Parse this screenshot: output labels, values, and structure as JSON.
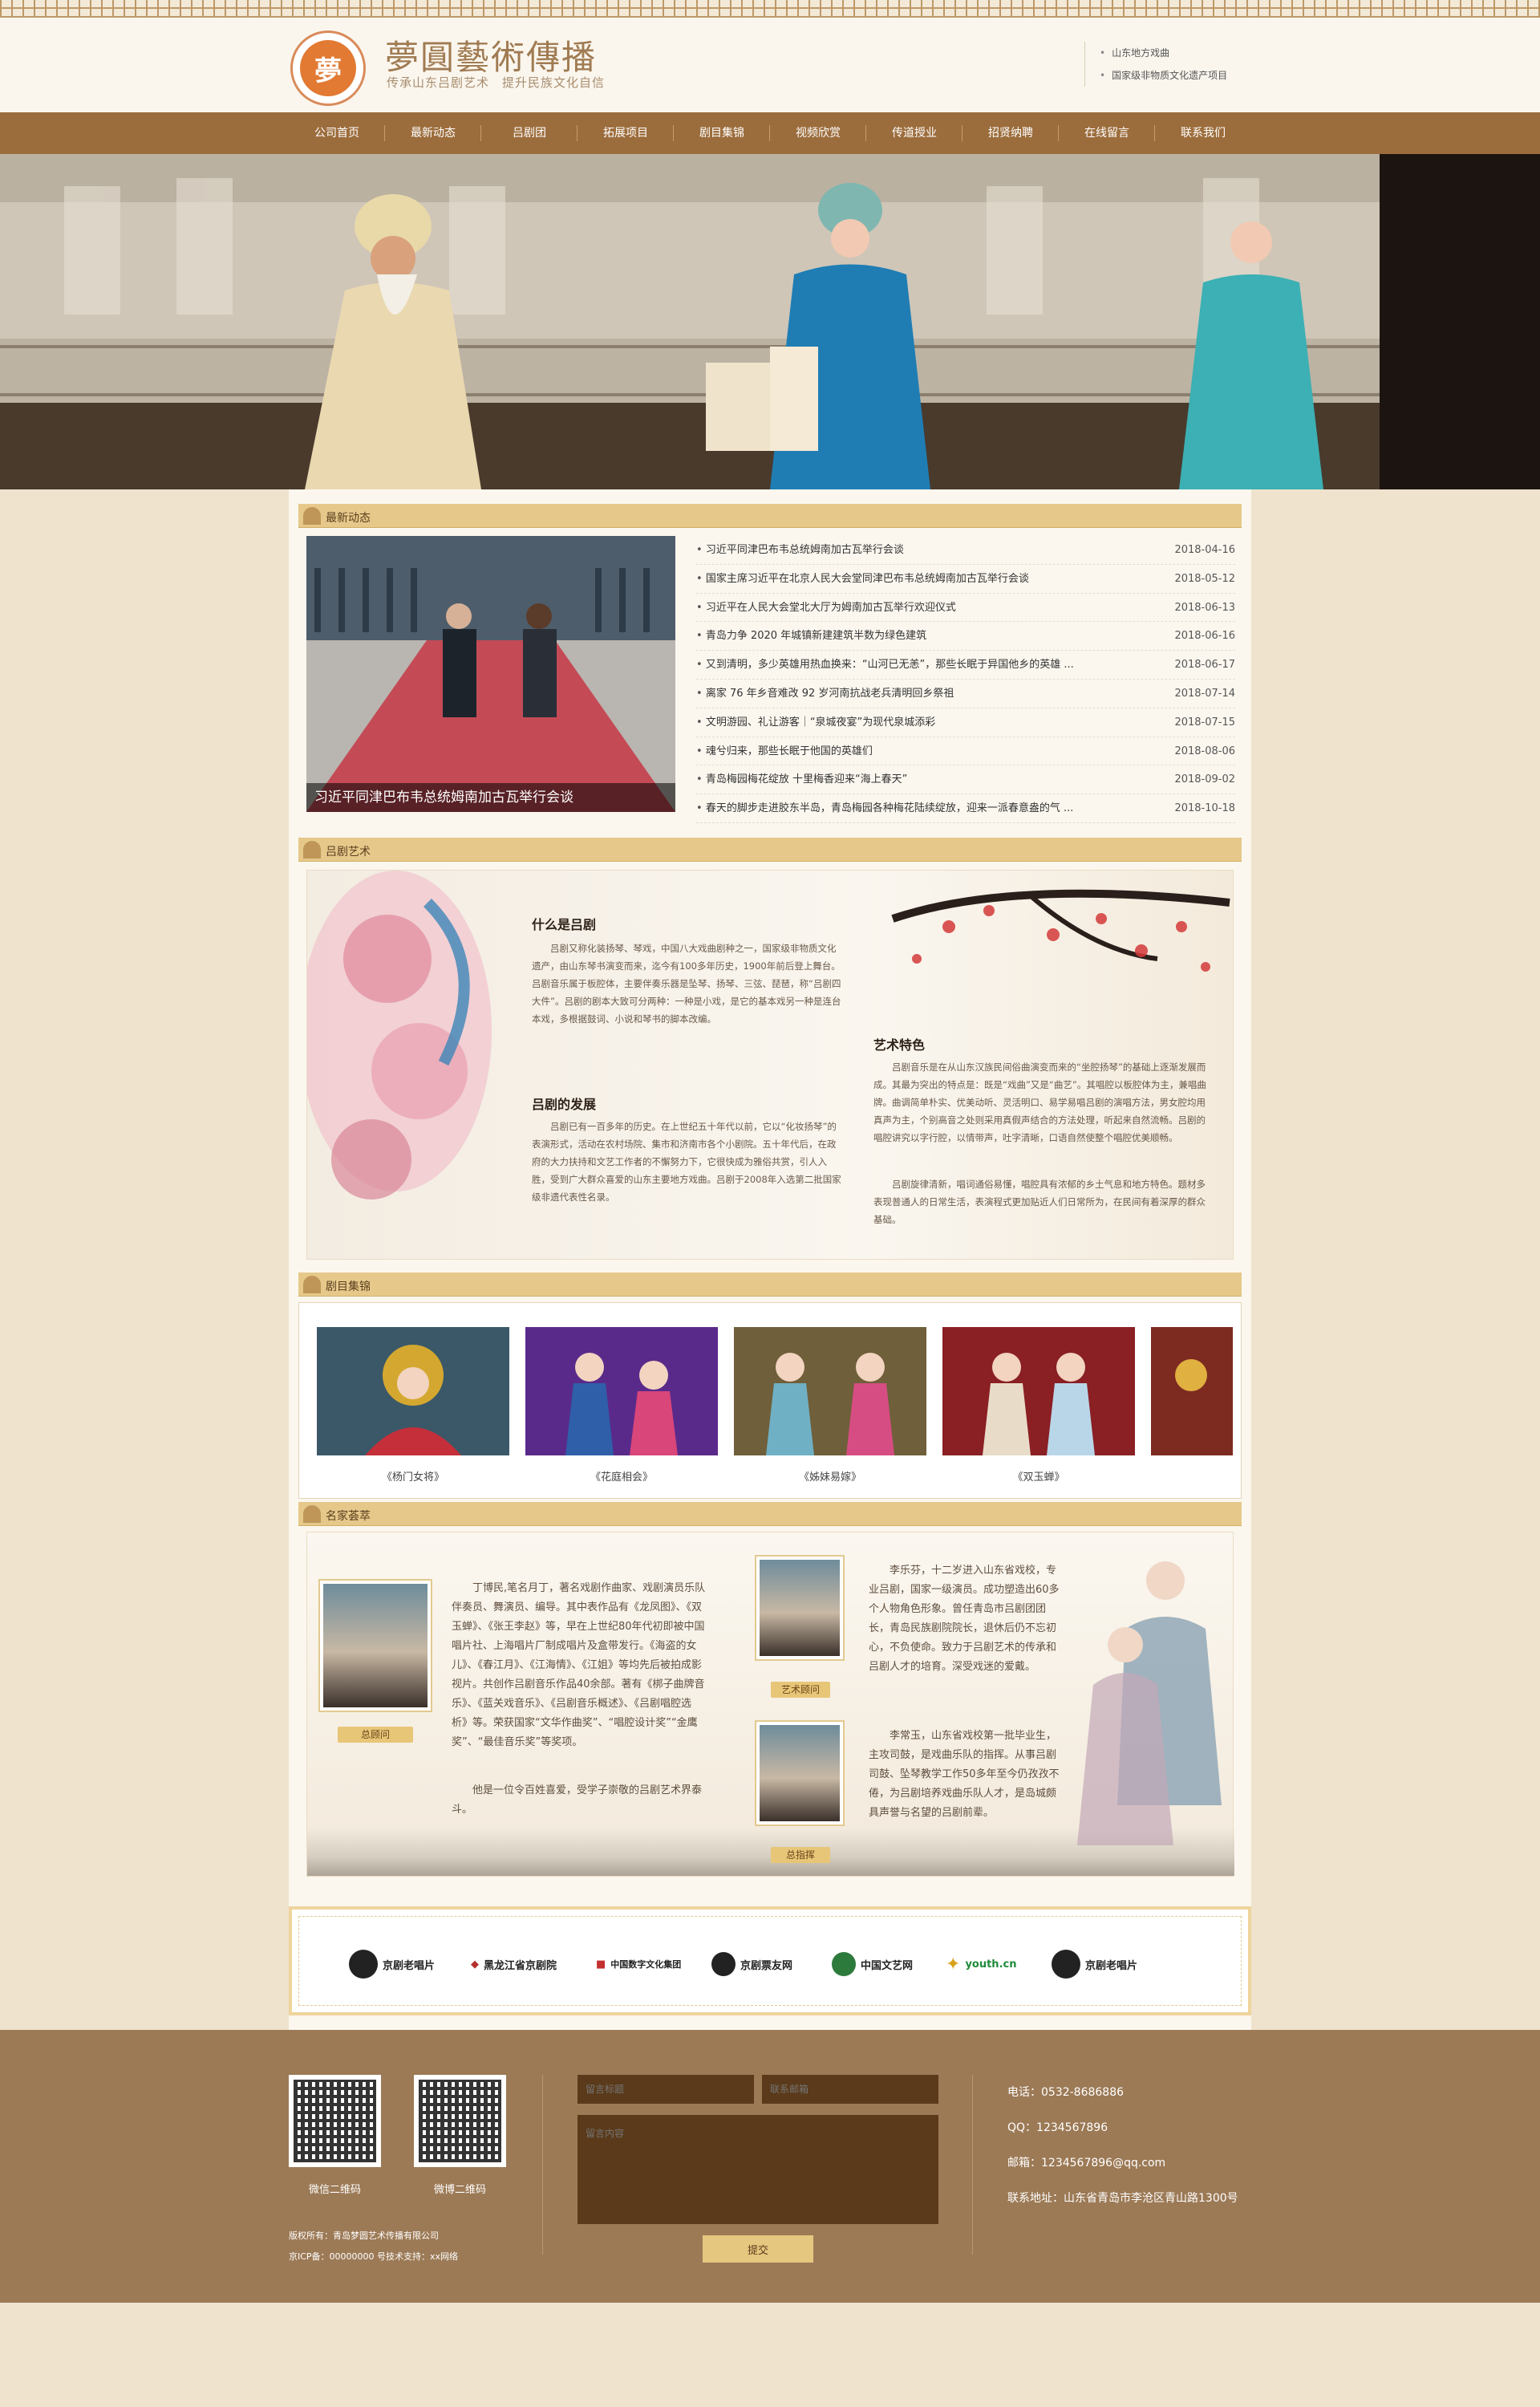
{
  "header": {
    "seal_text": "夢",
    "brand_title": "夢圓藝術傳播",
    "brand_subtitle": "传承山东吕剧艺术　提升民族文化自信",
    "links": [
      "山东地方戏曲",
      "国家级非物质文化遗产项目"
    ]
  },
  "nav": {
    "items": [
      "公司首页",
      "最新动态",
      "吕剧团",
      "拓展项目",
      "剧目集锦",
      "视频欣赏",
      "传道授业",
      "招贤纳聘",
      "在线留言",
      "联系我们"
    ]
  },
  "news": {
    "section_title": "最新动态",
    "image_caption": "习近平同津巴布韦总统姆南加古瓦举行会谈",
    "items": [
      {
        "title": "习近平同津巴布韦总统姆南加古瓦举行会谈",
        "date": "2018-04-16"
      },
      {
        "title": "国家主席习近平在北京人民大会堂同津巴布韦总统姆南加古瓦举行会谈",
        "date": "2018-05-12"
      },
      {
        "title": "习近平在人民大会堂北大厅为姆南加古瓦举行欢迎仪式",
        "date": "2018-06-13"
      },
      {
        "title": "青岛力争 2020 年城镇新建建筑半数为绿色建筑",
        "date": "2018-06-16"
      },
      {
        "title": "又到清明，多少英雄用热血换来：“山河已无恙”，那些长眠于异国他乡的英雄 ...",
        "date": "2018-06-17"
      },
      {
        "title": "离家 76 年乡音难改 92 岁河南抗战老兵清明回乡祭祖",
        "date": "2018-07-14"
      },
      {
        "title": "文明游园、礼让游客｜“泉城夜宴”为现代泉城添彩",
        "date": "2018-07-15"
      },
      {
        "title": "魂兮归来，那些长眠于他国的英雄们",
        "date": "2018-08-06"
      },
      {
        "title": "青岛梅园梅花绽放 十里梅香迎来“海上春天”",
        "date": "2018-09-02"
      },
      {
        "title": "春天的脚步走进胶东半岛，青岛梅园各种梅花陆续绽放，迎来一派春意盎的气 ...",
        "date": "2018-10-18"
      }
    ]
  },
  "art": {
    "section_title": "吕剧艺术",
    "what_title": "什么是吕剧",
    "what_text": "吕剧又称化装扬琴、琴戏，中国八大戏曲剧种之一，国家级非物质文化遗产，由山东琴书演变而来，迄今有100多年历史，1900年前后登上舞台。吕剧音乐属于板腔体，主要伴奏乐器是坠琴、扬琴、三弦、琵琶，称“吕剧四大件”。吕剧的剧本大致可分两种：一种是小戏，是它的基本戏另一种是连台本戏，多根据鼓词、小说和琴书的脚本改编。",
    "dev_title": "吕剧的发展",
    "dev_text": "吕剧已有一百多年的历史。在上世纪五十年代以前，它以“化妆扬琴”的表演形式，活动在农村场院、集市和济南市各个小剧院。五十年代后，在政府的大力扶持和文艺工作者的不懈努力下，它很快成为雅俗共赏，引人入胜，受到广大群众喜爱的山东主要地方戏曲。吕剧于2008年入选第二批国家级非遗代表性名录。",
    "feature_title": "艺术特色",
    "feature_text1": "吕剧音乐是在从山东汉族民间俗曲演变而来的“坐腔扬琴”的基础上逐渐发展而成。其最为突出的特点是：既是“戏曲”又是“曲艺”。其唱腔以板腔体为主，兼唱曲牌。曲调简单朴实、优美动听、灵活明口、易学易唱吕剧的演唱方法，男女腔均用真声为主，个别高音之处则采用真假声结合的方法处理，听起来自然流畅。吕剧的唱腔讲究以字行腔，以情带声，吐字清晰，口语自然使整个唱腔优美顺畅。",
    "feature_text2": "吕剧旋律清新，唱词通俗易懂，唱腔具有浓郁的乡土气息和地方特色。题材多表现普通人的日常生活，表演程式更加贴近人们日常所为，在民间有着深厚的群众基础。"
  },
  "repertoire": {
    "section_title": "剧目集锦",
    "items": [
      "《杨门女将》",
      "《花庭相会》",
      "《姊妹易嫁》",
      "《双玉蝉》"
    ]
  },
  "masters": {
    "section_title": "名家荟萃",
    "m1_tag": "总顾问",
    "m1_text": "丁博民,笔名月丁，著名戏剧作曲家、戏剧演员乐队伴奏员、舞演员、编导。其中表作品有《龙凤图》、《双玉蝉》、《张王李赵》等，早在上世纪80年代初即被中国唱片社、上海唱片厂制成唱片及盒带发行。《海盗的女儿》、《春江月》、《江海情》、《江姐》等均先后被拍成影视片。共创作吕剧音乐作品40余部。著有《梆子曲牌音乐》、《蓝关戏音乐》、《吕剧音乐概述》、《吕剧唱腔选析》等。荣获国家“文华作曲奖”、“唱腔设计奖”“金鹰奖”、“最佳音乐奖”等奖项。",
    "m1_text2": "他是一位令百姓喜爱，受学子崇敬的吕剧艺术界泰斗。",
    "m2_tag": "艺术顾问",
    "m2_text": "李乐芬，十二岁进入山东省戏校，专业吕剧，国家一级演员。成功塑造出60多个人物角色形象。曾任青岛市吕剧团团长，青岛民族剧院院长，退休后仍不忘初心，不负使命。致力于吕剧艺术的传承和吕剧人才的培育。深受戏迷的爱戴。",
    "m3_tag": "总指挥",
    "m3_text": "李常玉，山东省戏校第一批毕业生，主攻司鼓，是戏曲乐队的指挥。从事吕剧司鼓、坠琴教学工作50多年至今仍孜孜不倦，为吕剧培养戏曲乐队人才，是岛城颇具声誉与名望的吕剧前辈。"
  },
  "partners": {
    "logos": [
      "京剧老唱片",
      "黑龙江省京剧院",
      "中国数字文化集团",
      "京剧票友网",
      "中国文艺网",
      "youth.cn",
      "京剧老唱片"
    ]
  },
  "footer": {
    "qr_labels": [
      "微信二维码",
      "微博二维码"
    ],
    "copyright": "版权所有：青岛梦圆艺术传播有限公司",
    "icp": "京ICP备：00000000 号技术支持：xx网络",
    "form": {
      "title_placeholder": "留言标题",
      "email_placeholder": "联系邮箱",
      "content_placeholder": "留言内容",
      "submit_label": "提交"
    },
    "contact": [
      "电话：0532-8686886",
      "QQ：1234567896",
      "邮箱：1234567896@qq.com",
      "联系地址：山东省青岛市李沧区青山路1300号"
    ]
  },
  "colors": {
    "nav_bg": "#9c6d3c",
    "section_head": "#e6c98a",
    "footer_bg": "#9c7a56",
    "form_bg": "#5a3a1a"
  }
}
